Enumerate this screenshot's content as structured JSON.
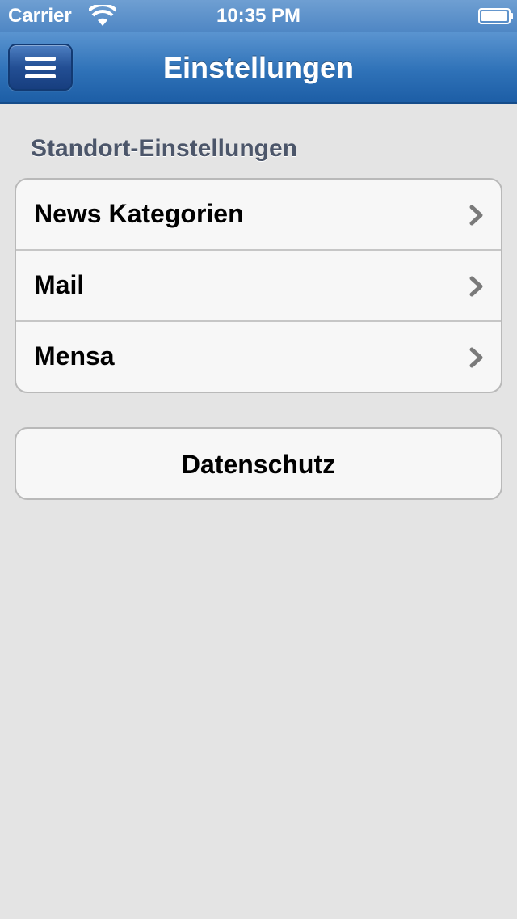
{
  "status_bar": {
    "carrier": "Carrier",
    "time": "10:35 PM",
    "wifi_icon": "wifi-icon",
    "battery_icon": "battery-icon"
  },
  "nav_bar": {
    "title": "Einstellungen",
    "menu_icon": "hamburger-menu-icon"
  },
  "settings": {
    "section_header": "Standort-Einstellungen",
    "items": [
      {
        "label": "News Kategorien",
        "icon": "chevron-right-icon"
      },
      {
        "label": "Mail",
        "icon": "chevron-right-icon"
      },
      {
        "label": "Mensa",
        "icon": "chevron-right-icon"
      }
    ]
  },
  "privacy": {
    "label": "Datenschutz"
  },
  "colors": {
    "nav_bar": "#2f72b8",
    "status_bar": "#5a8fc9",
    "background": "#e4e4e4",
    "cell_background": "#f7f7f7",
    "section_header_text": "#4c566a",
    "chevron": "#7a7a7a"
  }
}
